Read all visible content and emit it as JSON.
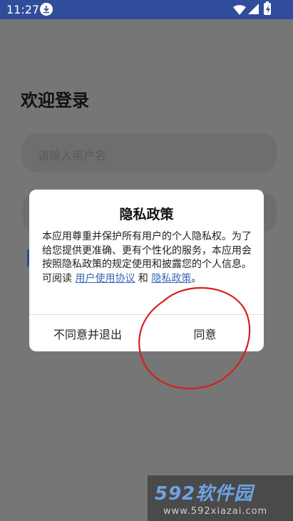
{
  "status_bar": {
    "time": "11:27",
    "icons": [
      "download-icon",
      "wifi-icon",
      "signal-icon",
      "battery-icon"
    ]
  },
  "login": {
    "title": "欢迎登录",
    "username_placeholder": "请输入用户名"
  },
  "dialog": {
    "title": "隐私政策",
    "body_text": "本应用尊重并保护所有用户的个人隐私权。为了给您提供更准确、更有个性化的服务，本应用会按照隐私政策的规定使用和披露您的个人信息。可阅读 ",
    "link_user_agreement": "用户使用协议",
    "connector": " 和 ",
    "link_privacy_policy": "隐私政策",
    "end_punct": "。",
    "decline_label": "不同意并退出",
    "agree_label": "同意"
  },
  "watermark": {
    "brand": "592软件园",
    "url": "www.592xiazai.com"
  },
  "colors": {
    "status_bar": "#2f4d9a",
    "overlay": "#767676",
    "link": "#3a69b4",
    "annotation": "#d42020"
  }
}
